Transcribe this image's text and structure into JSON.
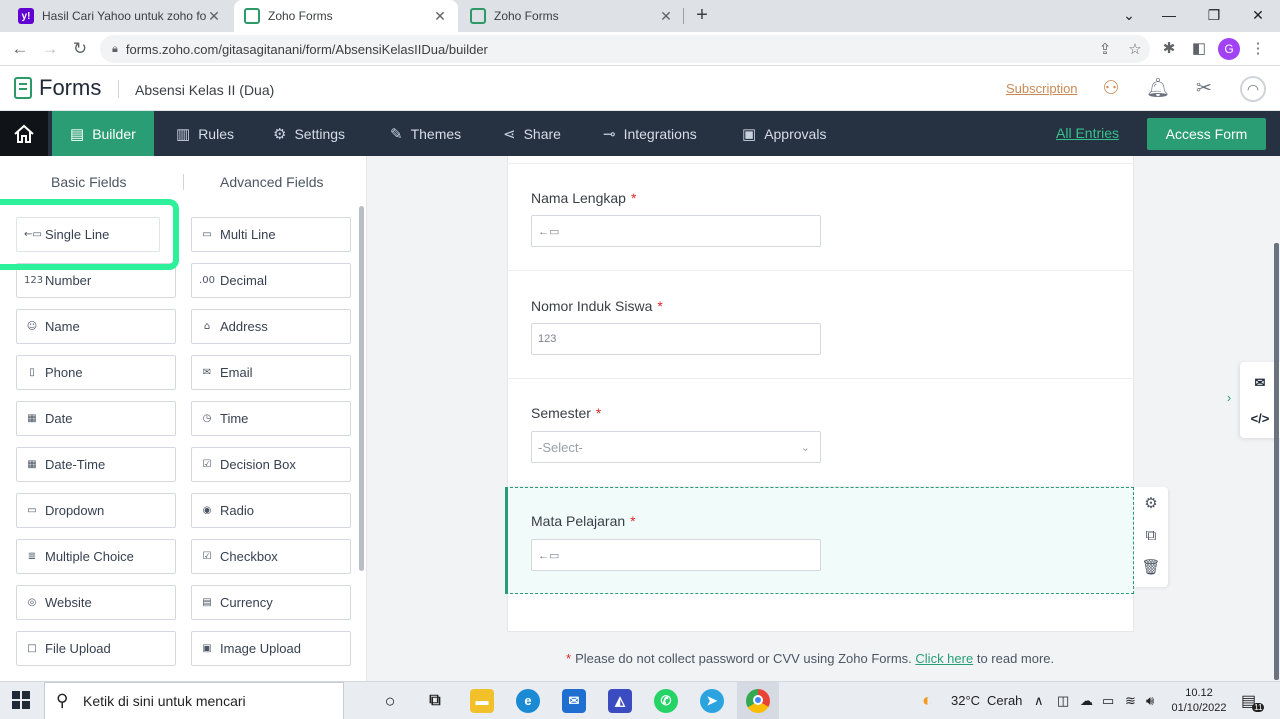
{
  "browser": {
    "tabs": [
      {
        "title": "Hasil Cari Yahoo untuk zoho form",
        "favicon": "yahoo-icon",
        "active": false
      },
      {
        "title": "Zoho Forms",
        "favicon": "zoho-forms-icon",
        "active": true
      },
      {
        "title": "Zoho Forms",
        "favicon": "zoho-forms-icon",
        "active": false
      }
    ],
    "url": "forms.zoho.com/gitasagitanani/form/AbsensiKelasIIDua/builder",
    "profile_initial": "G"
  },
  "header": {
    "app_name": "Forms",
    "form_name": "Absensi Kelas II (Dua)",
    "subscription_label": "Subscription"
  },
  "nav": {
    "items": [
      {
        "label": "Builder",
        "icon": "builder-icon",
        "active": true
      },
      {
        "label": "Rules",
        "icon": "rules-icon"
      },
      {
        "label": "Settings",
        "icon": "gear-icon"
      },
      {
        "label": "Themes",
        "icon": "brush-icon"
      },
      {
        "label": "Share",
        "icon": "share-icon"
      },
      {
        "label": "Integrations",
        "icon": "plug-icon"
      },
      {
        "label": "Approvals",
        "icon": "approvals-icon"
      }
    ],
    "all_entries_label": "All Entries",
    "access_form_label": "Access Form"
  },
  "fields_panel": {
    "tabs": [
      "Basic Fields",
      "Advanced Fields"
    ],
    "fields": [
      {
        "label": "Single Line",
        "glyph": "←▭"
      },
      {
        "label": "Multi Line",
        "glyph": "▭"
      },
      {
        "label": "Number",
        "glyph": "123"
      },
      {
        "label": "Decimal",
        "glyph": ".00"
      },
      {
        "label": "Name",
        "glyph": "☺"
      },
      {
        "label": "Address",
        "glyph": "⌂"
      },
      {
        "label": "Phone",
        "glyph": "▯"
      },
      {
        "label": "Email",
        "glyph": "✉"
      },
      {
        "label": "Date",
        "glyph": "▦"
      },
      {
        "label": "Time",
        "glyph": "◷"
      },
      {
        "label": "Date-Time",
        "glyph": "▦"
      },
      {
        "label": "Decision Box",
        "glyph": "☑"
      },
      {
        "label": "Dropdown",
        "glyph": "▭"
      },
      {
        "label": "Radio",
        "glyph": "◉"
      },
      {
        "label": "Multiple Choice",
        "glyph": "≣"
      },
      {
        "label": "Checkbox",
        "glyph": "☑"
      },
      {
        "label": "Website",
        "glyph": "◎"
      },
      {
        "label": "Currency",
        "glyph": "▤"
      },
      {
        "label": "File Upload",
        "glyph": "□"
      },
      {
        "label": "Image Upload",
        "glyph": "▣"
      }
    ]
  },
  "form": {
    "fields": [
      {
        "label": "Nama Lengkap",
        "required": "*",
        "type": "single-line",
        "placeholder_glyph": "←▭"
      },
      {
        "label": "Nomor Induk Siswa",
        "required": "*",
        "type": "number",
        "placeholder_glyph": "123"
      },
      {
        "label": "Semester",
        "required": "*",
        "type": "dropdown",
        "value": "-Select-"
      },
      {
        "label": "Mata Pelajaran",
        "required": "*",
        "type": "single-line",
        "placeholder_glyph": "←▭",
        "selected": true
      }
    ],
    "footnote_star": "*",
    "footnote_text": "Please do not collect password or CVV using Zoho Forms.",
    "footnote_link": "Click here",
    "footnote_after": "to read more."
  },
  "taskbar": {
    "search_placeholder": "Ketik di sini untuk mencari",
    "weather": "32°C",
    "weather_desc": "Cerah",
    "time": "10.12",
    "date": "01/10/2022",
    "notification_count": "11"
  },
  "colors": {
    "accent": "#2a9d74",
    "navbar": "#263142",
    "highlight": "#2df09a",
    "required": "#e02828"
  }
}
